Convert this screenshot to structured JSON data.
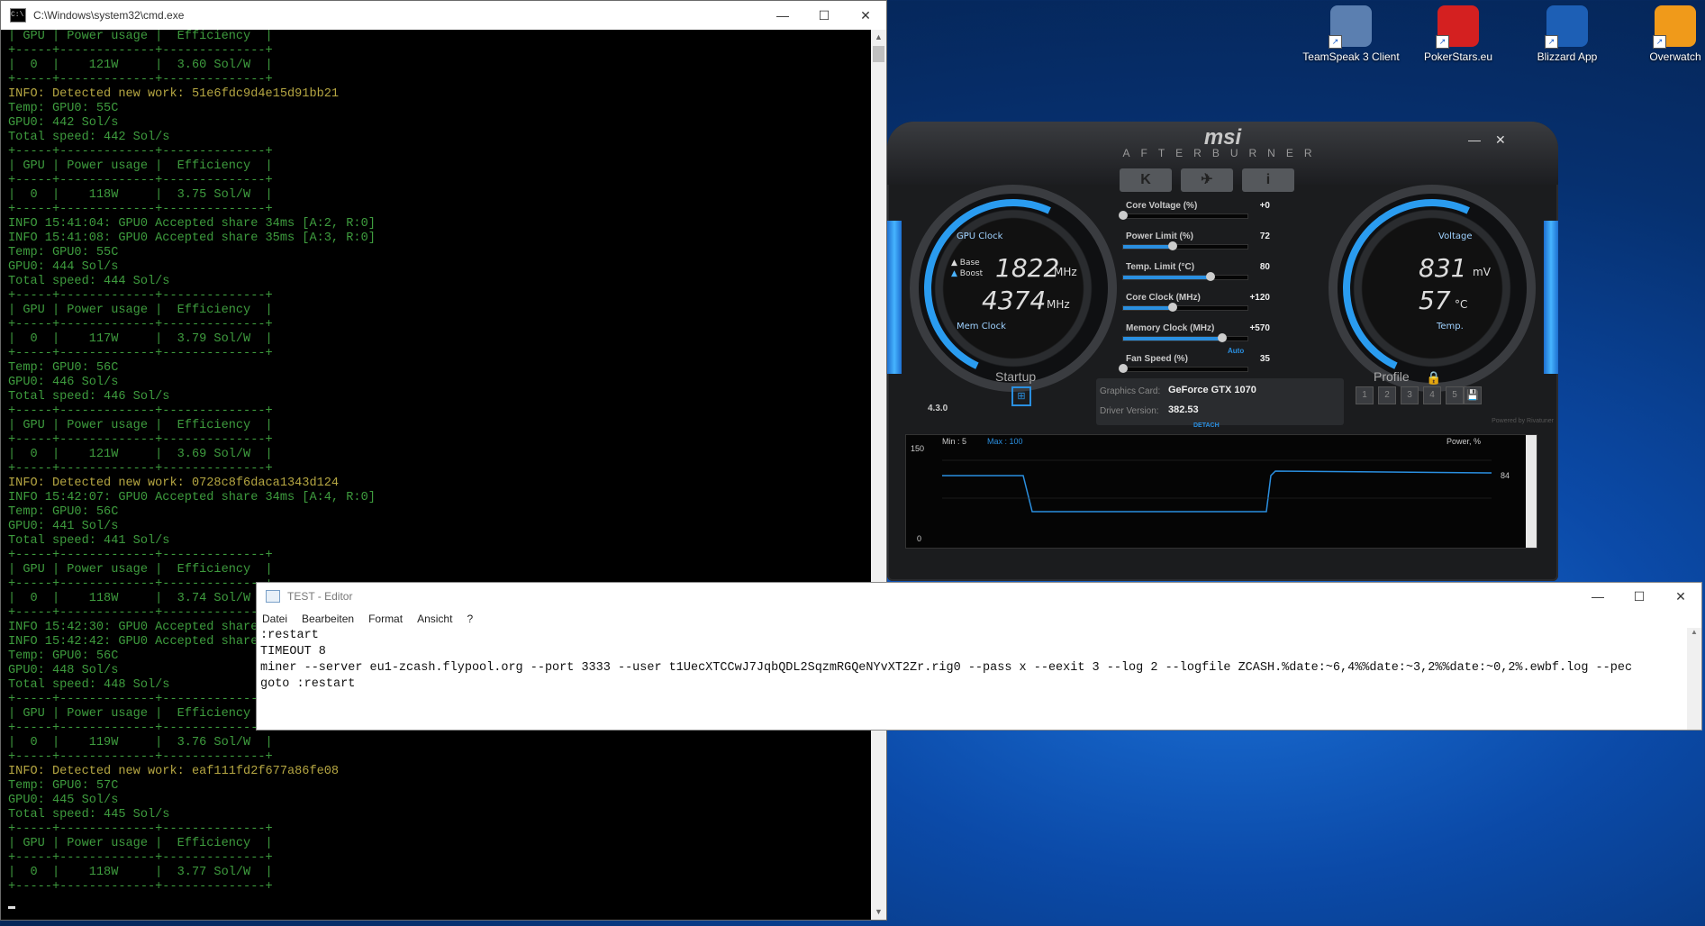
{
  "cmd": {
    "title": "C:\\Windows\\system32\\cmd.exe",
    "lines": [
      {
        "t": "| GPU | Power usage |  Efficiency  |",
        "c": "g"
      },
      {
        "t": "+-----+-------------+--------------+",
        "c": "g"
      },
      {
        "t": "|  0  |    121W     |  3.60 Sol/W  |",
        "c": "g"
      },
      {
        "t": "+-----+-------------+--------------+",
        "c": "g"
      },
      {
        "t": "INFO: Detected new work: 51e6fdc9d4e15d91bb21",
        "c": "y"
      },
      {
        "t": "Temp: GPU0: 55C",
        "c": "g"
      },
      {
        "t": "GPU0: 442 Sol/s",
        "c": "g"
      },
      {
        "t": "Total speed: 442 Sol/s",
        "c": "g"
      },
      {
        "t": "+-----+-------------+--------------+",
        "c": "g"
      },
      {
        "t": "| GPU | Power usage |  Efficiency  |",
        "c": "g"
      },
      {
        "t": "+-----+-------------+--------------+",
        "c": "g"
      },
      {
        "t": "|  0  |    118W     |  3.75 Sol/W  |",
        "c": "g"
      },
      {
        "t": "+-----+-------------+--------------+",
        "c": "g"
      },
      {
        "t": "INFO 15:41:04: GPU0 Accepted share 34ms [A:2, R:0]",
        "c": "g"
      },
      {
        "t": "INFO 15:41:08: GPU0 Accepted share 35ms [A:3, R:0]",
        "c": "g"
      },
      {
        "t": "Temp: GPU0: 55C",
        "c": "g"
      },
      {
        "t": "GPU0: 444 Sol/s",
        "c": "g"
      },
      {
        "t": "Total speed: 444 Sol/s",
        "c": "g"
      },
      {
        "t": "+-----+-------------+--------------+",
        "c": "g"
      },
      {
        "t": "| GPU | Power usage |  Efficiency  |",
        "c": "g"
      },
      {
        "t": "+-----+-------------+--------------+",
        "c": "g"
      },
      {
        "t": "|  0  |    117W     |  3.79 Sol/W  |",
        "c": "g"
      },
      {
        "t": "+-----+-------------+--------------+",
        "c": "g"
      },
      {
        "t": "Temp: GPU0: 56C",
        "c": "g"
      },
      {
        "t": "GPU0: 446 Sol/s",
        "c": "g"
      },
      {
        "t": "Total speed: 446 Sol/s",
        "c": "g"
      },
      {
        "t": "+-----+-------------+--------------+",
        "c": "g"
      },
      {
        "t": "| GPU | Power usage |  Efficiency  |",
        "c": "g"
      },
      {
        "t": "+-----+-------------+--------------+",
        "c": "g"
      },
      {
        "t": "|  0  |    121W     |  3.69 Sol/W  |",
        "c": "g"
      },
      {
        "t": "+-----+-------------+--------------+",
        "c": "g"
      },
      {
        "t": "INFO: Detected new work: 0728c8f6daca1343d124",
        "c": "y"
      },
      {
        "t": "INFO 15:42:07: GPU0 Accepted share 34ms [A:4, R:0]",
        "c": "g"
      },
      {
        "t": "Temp: GPU0: 56C",
        "c": "g"
      },
      {
        "t": "GPU0: 441 Sol/s",
        "c": "g"
      },
      {
        "t": "Total speed: 441 Sol/s",
        "c": "g"
      },
      {
        "t": "+-----+-------------+--------------+",
        "c": "g"
      },
      {
        "t": "| GPU | Power usage |  Efficiency  |",
        "c": "g"
      },
      {
        "t": "+-----+-------------+--------------+",
        "c": "g"
      },
      {
        "t": "|  0  |    118W     |  3.74 Sol/W  |",
        "c": "g"
      },
      {
        "t": "+-----+-------------+--------------+",
        "c": "g"
      },
      {
        "t": "INFO 15:42:30: GPU0 Accepted share",
        "c": "g"
      },
      {
        "t": "INFO 15:42:42: GPU0 Accepted share",
        "c": "g"
      },
      {
        "t": "Temp: GPU0: 56C",
        "c": "g"
      },
      {
        "t": "GPU0: 448 Sol/s",
        "c": "g"
      },
      {
        "t": "Total speed: 448 Sol/s",
        "c": "g"
      },
      {
        "t": "+-----+-------------+--------------+",
        "c": "g"
      },
      {
        "t": "| GPU | Power usage |  Efficiency  |",
        "c": "g"
      },
      {
        "t": "+-----+-------------+--------------+",
        "c": "g"
      },
      {
        "t": "|  0  |    119W     |  3.76 Sol/W  |",
        "c": "g"
      },
      {
        "t": "+-----+-------------+--------------+",
        "c": "g"
      },
      {
        "t": "INFO: Detected new work: eaf111fd2f677a86fe08",
        "c": "y"
      },
      {
        "t": "Temp: GPU0: 57C",
        "c": "g"
      },
      {
        "t": "GPU0: 445 Sol/s",
        "c": "g"
      },
      {
        "t": "Total speed: 445 Sol/s",
        "c": "g"
      },
      {
        "t": "+-----+-------------+--------------+",
        "c": "g"
      },
      {
        "t": "| GPU | Power usage |  Efficiency  |",
        "c": "g"
      },
      {
        "t": "+-----+-------------+--------------+",
        "c": "g"
      },
      {
        "t": "|  0  |    118W     |  3.77 Sol/W  |",
        "c": "g"
      },
      {
        "t": "+-----+-------------+--------------+",
        "c": "g"
      }
    ]
  },
  "desktop": {
    "icons": [
      {
        "label": "TeamSpeak 3 Client",
        "icon": "teamspeak-icon",
        "color": "#5b7fb0"
      },
      {
        "label": "PokerStars.eu",
        "icon": "pokerstars-icon",
        "color": "#d42020"
      },
      {
        "label": "Blizzard App",
        "icon": "blizzard-icon",
        "color": "#1d5fb5"
      },
      {
        "label": "Overwatch",
        "icon": "overwatch-icon",
        "color": "#f09a1a"
      }
    ]
  },
  "afterburner": {
    "brand": "msi",
    "subtitle": "AFTERBURNER",
    "top_buttons": [
      "K",
      "✈",
      "i"
    ],
    "gpu_clock_label": "GPU Clock",
    "base_label": "Base",
    "boost_label": "Boost",
    "gpu_clock_value": "1822",
    "gpu_clock_unit": "MHz",
    "mem_clock_value": "4374",
    "mem_clock_unit": "MHz",
    "mem_clock_label": "Mem Clock",
    "voltage_label": "Voltage",
    "voltage_value": "831",
    "voltage_unit": "mV",
    "temp_value": "57",
    "temp_unit": "°C",
    "temp_label": "Temp.",
    "sliders": [
      {
        "label": "Core Voltage (%)",
        "value": "+0",
        "level": 0
      },
      {
        "label": "Power Limit (%)",
        "value": "72",
        "level": 0.4
      },
      {
        "label": "Temp. Limit (°C)",
        "value": "80",
        "level": 0.7
      },
      {
        "label": "Core Clock (MHz)",
        "value": "+120",
        "level": 0.4
      },
      {
        "label": "Memory Clock (MHz)",
        "value": "+570",
        "level": 0.8
      },
      {
        "label": "Fan Speed (%)",
        "value": "35",
        "level": 0.0
      }
    ],
    "fan_auto": "Auto",
    "startup_label": "Startup",
    "profile_label": "Profile",
    "graphics_card_label": "Graphics Card:",
    "graphics_card_value": "GeForce GTX 1070",
    "driver_label": "Driver Version:",
    "driver_value": "382.53",
    "detach": "DETACH",
    "version": "4.3.0",
    "powered_by": "Powered by Rivatuner",
    "profile_slots": [
      "1",
      "2",
      "3",
      "4",
      "5"
    ],
    "graph": {
      "min_label": "Min : 5",
      "max_label": "Max : 100",
      "series_label": "Power, %",
      "y_top": "150",
      "y_bottom": "0",
      "current": "84",
      "line_color": "#2a8fe0"
    }
  },
  "notepad": {
    "title": "TEST - Editor",
    "menu": [
      "Datei",
      "Bearbeiten",
      "Format",
      "Ansicht",
      "?"
    ],
    "lines": [
      ":restart",
      "TIMEOUT 8",
      "miner --server eu1-zcash.flypool.org --port 3333 --user t1UecXTCCwJ7JqbQDL2SqzmRGQeNYvXT2Zr.rig0 --pass x --eexit 3 --log 2 --logfile ZCASH.%date:~6,4%%date:~3,2%%date:~0,2%.ewbf.log --pec",
      "goto :restart"
    ]
  }
}
